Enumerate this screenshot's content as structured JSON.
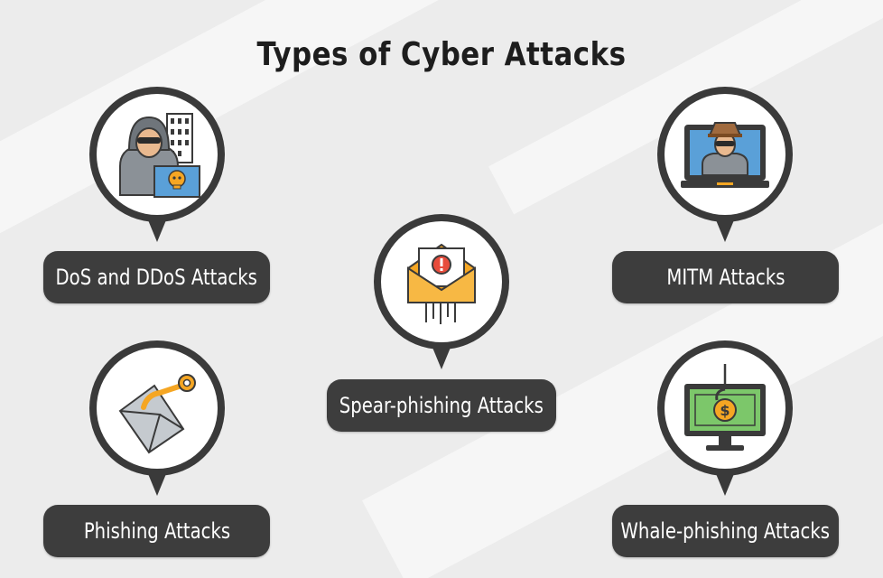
{
  "title": "Types of Cyber Attacks",
  "colors": {
    "pin": "#3a3a3a",
    "label_bg": "#3d3d3d",
    "label_text": "#ffffff",
    "background": "#ececec",
    "accent_orange": "#f5a623",
    "accent_red": "#e74c3c",
    "accent_blue": "#5aa0d8",
    "accent_green": "#7cc76a"
  },
  "attacks": [
    {
      "label": "DoS and DDoS Attacks",
      "icon": "hacker-laptop-icon"
    },
    {
      "label": "MITM Attacks",
      "icon": "spy-monitor-icon"
    },
    {
      "label": "Spear-phishing Attacks",
      "icon": "alert-envelope-icon"
    },
    {
      "label": "Phishing Attacks",
      "icon": "hooked-envelope-icon"
    },
    {
      "label": "Whale-phishing Attacks",
      "icon": "dollar-hook-monitor-icon"
    }
  ]
}
